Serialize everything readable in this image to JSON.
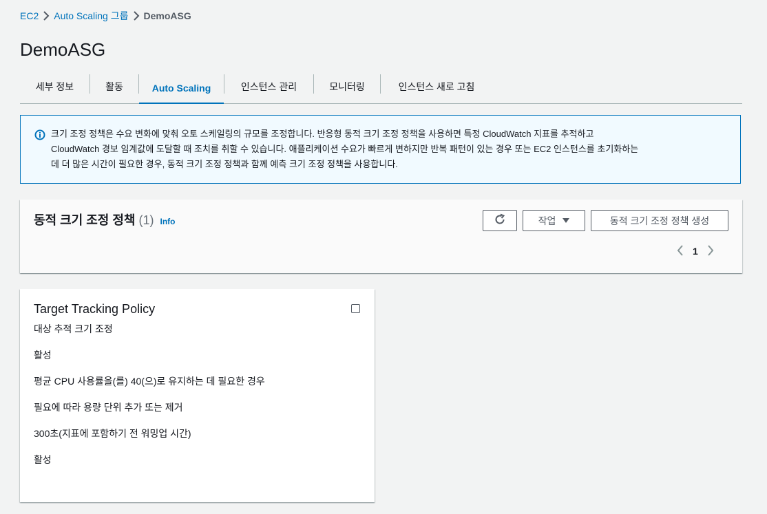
{
  "breadcrumb": {
    "items": [
      "EC2",
      "Auto Scaling 그룹"
    ],
    "current": "DemoASG"
  },
  "page_title": "DemoASG",
  "tabs": [
    {
      "label": "세부 정보"
    },
    {
      "label": "활동"
    },
    {
      "label": "Auto Scaling",
      "active": true
    },
    {
      "label": "인스턴스 관리"
    },
    {
      "label": "모니터링"
    },
    {
      "label": "인스턴스 새로 고침"
    }
  ],
  "info_alert": {
    "icon": "info-circle-icon",
    "line1": "크기 조정 정책은 수요 변화에 맞춰 오토 스케일링의 규모를 조정합니다. 반응형 동적 크기 조정 정책을 사용하면 특정 CloudWatch 지표를 추적하고",
    "line2": "CloudWatch 경보 임계값에 도달할 때 조치를 취할 수 있습니다. 애플리케이션 수요가 빠르게 변하지만 반복 패턴이 있는 경우 또는 EC2 인스턴스를 초기화하는",
    "line3": "데 더 많은 시간이 필요한 경우, 동적 크기 조정 정책과 함께 예측 크기 조정 정책을 사용합니다."
  },
  "policies_panel": {
    "title": "동적 크기 조정 정책",
    "count": "(1)",
    "info_link": "Info",
    "actions_label": "작업",
    "create_label": "동적 크기 조정 정책 생성",
    "page_number": "1"
  },
  "policy_card": {
    "title": "Target Tracking Policy",
    "rows": [
      "대상 추적 크기 조정",
      "활성",
      "평균 CPU 사용률을(를) 40(으)로 유지하는 데 필요한 경우",
      "필요에 따라 용량 단위 추가 또는 제거",
      "300초(지표에 포함하기 전 워밍업 시간)",
      "활성"
    ]
  },
  "colors": {
    "link": "#0073bb",
    "alert_bg": "#f1faff",
    "page_bg": "#f2f3f3"
  }
}
